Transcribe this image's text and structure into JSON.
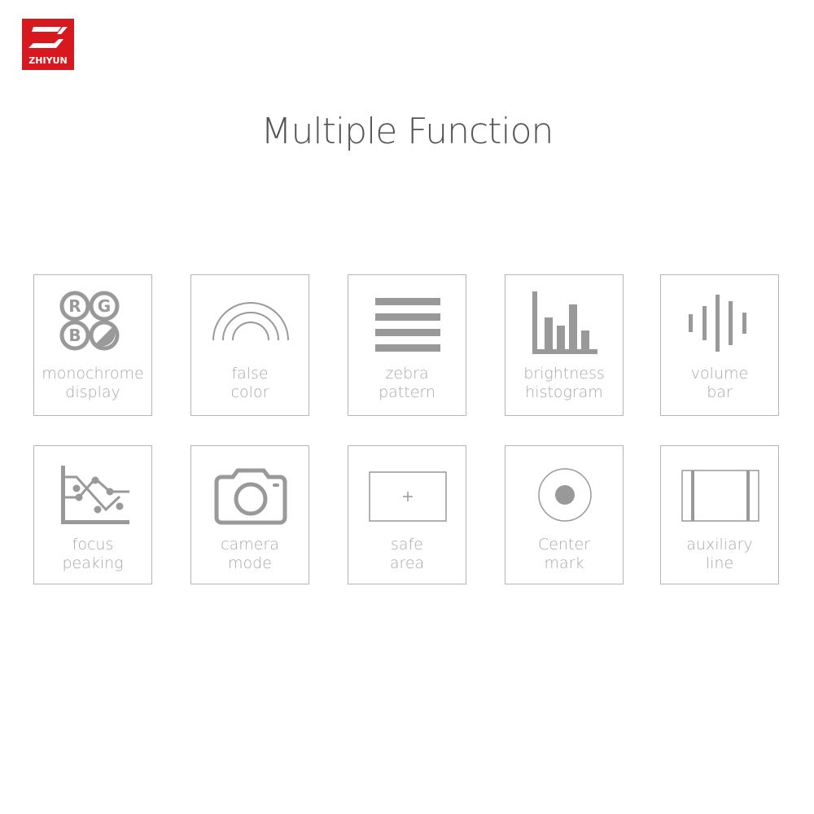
{
  "brand": {
    "name": "ZHIYUN",
    "color": "#d7191f"
  },
  "title": "Multiple Function",
  "icon_color": "#999999",
  "features": [
    {
      "icon": "rgb-circles-icon",
      "line1": "monochrome",
      "line2": "display",
      "letters": [
        "R",
        "G",
        "B"
      ]
    },
    {
      "icon": "rainbow-arcs-icon",
      "line1": "false",
      "line2": "color"
    },
    {
      "icon": "zebra-stripes-icon",
      "line1": "zebra",
      "line2": "pattern"
    },
    {
      "icon": "histogram-icon",
      "line1": "brightness",
      "line2": "histogram"
    },
    {
      "icon": "audio-bars-icon",
      "line1": "volume",
      "line2": "bar"
    },
    {
      "icon": "line-chart-icon",
      "line1": "focus",
      "line2": "peaking"
    },
    {
      "icon": "camera-icon",
      "line1": "camera",
      "line2": "mode"
    },
    {
      "icon": "safe-area-frame-icon",
      "line1": "safe",
      "line2": "area"
    },
    {
      "icon": "center-dot-icon",
      "line1": "Center",
      "line2": "mark"
    },
    {
      "icon": "guide-lines-icon",
      "line1": "auxiliary",
      "line2": "line"
    }
  ]
}
